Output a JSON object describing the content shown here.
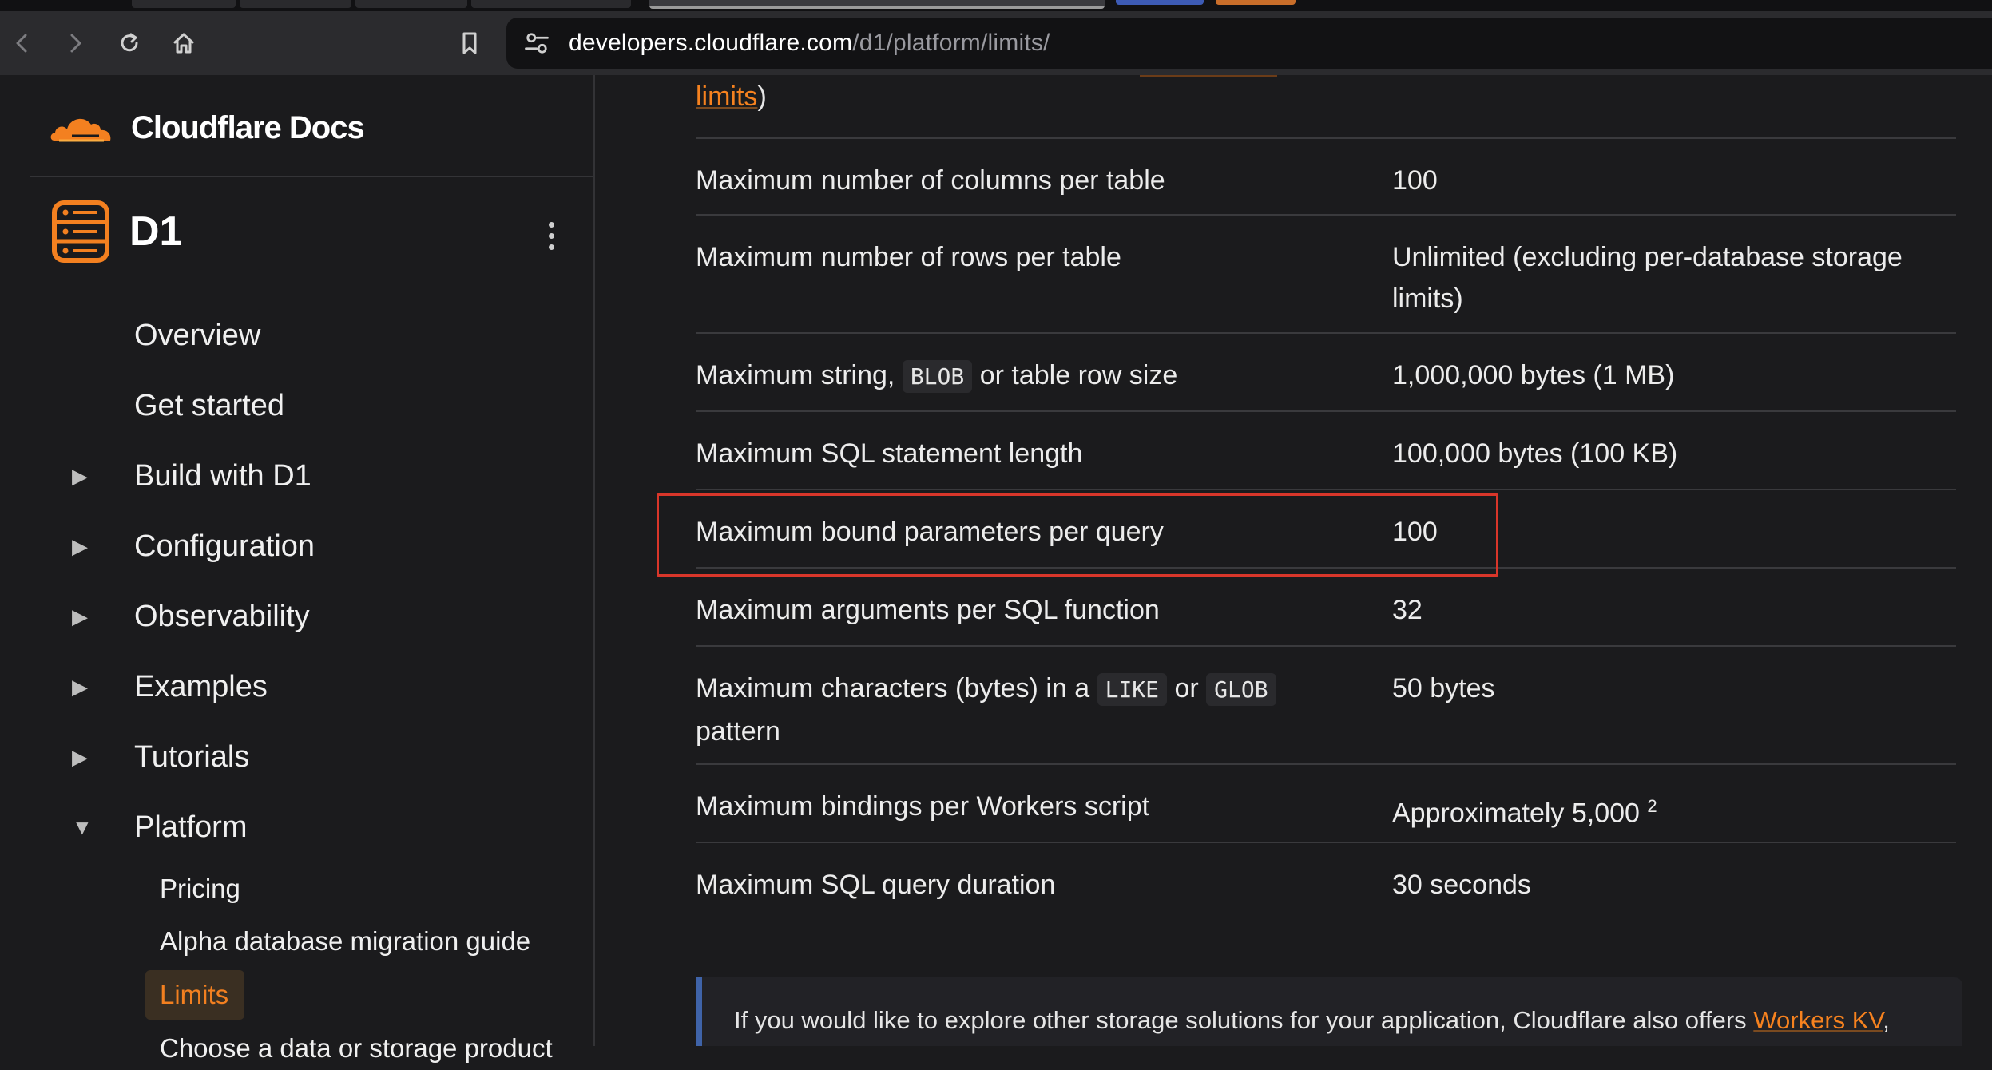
{
  "browser": {
    "url_host": "developers.cloudflare.com",
    "url_path": "/d1/platform/limits/"
  },
  "sidebar": {
    "brand": "Cloudflare Docs",
    "product": "D1",
    "items": [
      {
        "label": "Overview",
        "expandable": false
      },
      {
        "label": "Get started",
        "expandable": false
      },
      {
        "label": "Build with D1",
        "expandable": true,
        "expanded": false
      },
      {
        "label": "Configuration",
        "expandable": true,
        "expanded": false
      },
      {
        "label": "Observability",
        "expandable": true,
        "expanded": false
      },
      {
        "label": "Examples",
        "expandable": true,
        "expanded": false
      },
      {
        "label": "Tutorials",
        "expandable": true,
        "expanded": false
      },
      {
        "label": "Platform",
        "expandable": true,
        "expanded": true
      }
    ],
    "platform_children": [
      {
        "label": "Pricing"
      },
      {
        "label": "Alpha database migration guide"
      },
      {
        "label": "Limits",
        "active": true
      },
      {
        "label": "Choose a data or storage product"
      }
    ]
  },
  "main": {
    "top_link": "limits",
    "top_suffix": ")",
    "rows": [
      {
        "feature": "Maximum number of columns per table",
        "limit": "100"
      },
      {
        "feature": "Maximum number of rows per table",
        "limit": "Unlimited (excluding per-database storage limits)"
      },
      {
        "feature_parts": [
          "Maximum string, ",
          "BLOB",
          " or table row size"
        ],
        "limit": "1,000,000 bytes (1 MB)"
      },
      {
        "feature": "Maximum SQL statement length",
        "limit": "100,000 bytes (100 KB)"
      },
      {
        "feature": "Maximum bound parameters per query",
        "limit": "100",
        "highlighted": true
      },
      {
        "feature": "Maximum arguments per SQL function",
        "limit": "32"
      },
      {
        "feature_parts": [
          "Maximum characters (bytes) in a ",
          "LIKE",
          " or ",
          "GLOB",
          " pattern"
        ],
        "limit": "50 bytes"
      },
      {
        "feature": "Maximum bindings per Workers script",
        "limit": "Approximately 5,000",
        "limit_sup": "2"
      },
      {
        "feature": "Maximum SQL query duration",
        "limit": "30 seconds"
      }
    ],
    "note": {
      "text": "If you would like to explore other storage solutions for your application, Cloudflare also offers ",
      "link": "Workers KV",
      "after": ","
    }
  },
  "colors": {
    "accent": "#f6821f",
    "highlight_border": "#d9362a",
    "note_border": "#3f63a8"
  }
}
